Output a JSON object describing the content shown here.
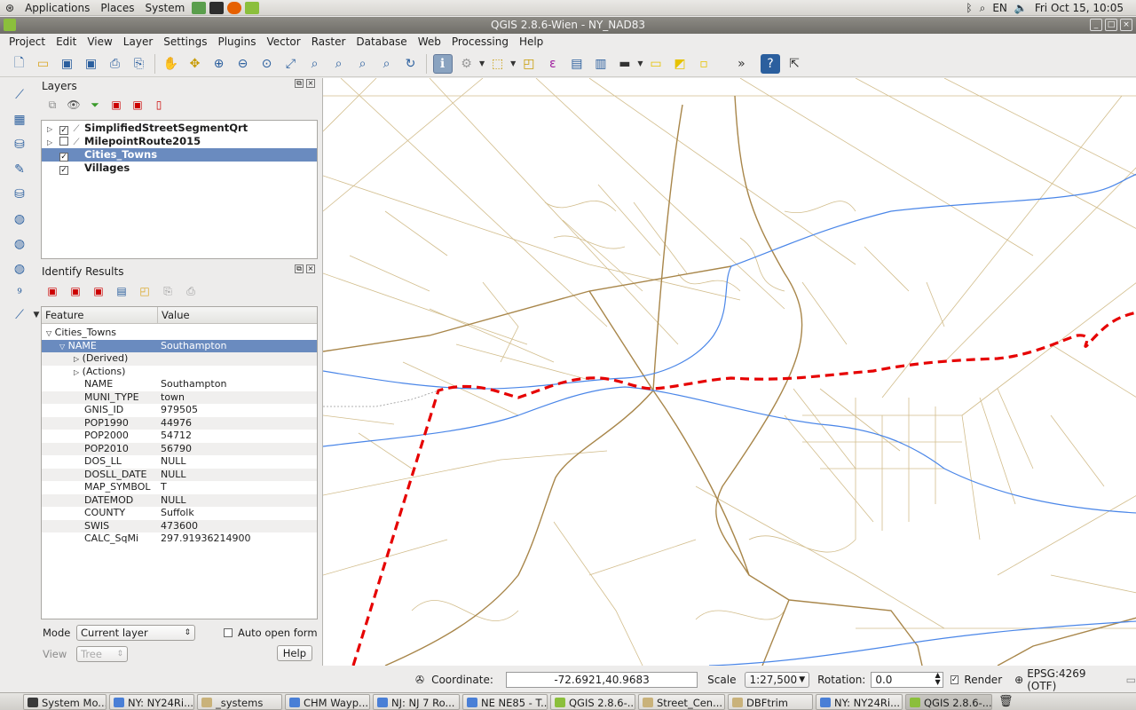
{
  "top_panel": {
    "applications": "Applications",
    "places": "Places",
    "system": "System",
    "lang": "EN",
    "clock": "Fri Oct 15, 10:05"
  },
  "window": {
    "title": "QGIS 2.8.6-Wien - NY_NAD83"
  },
  "menu": [
    "Project",
    "Edit",
    "View",
    "Layer",
    "Settings",
    "Plugins",
    "Vector",
    "Raster",
    "Database",
    "Web",
    "Processing",
    "Help"
  ],
  "toolbar": {
    "overflow": "»"
  },
  "layers_panel": {
    "title": "Layers",
    "items": [
      {
        "name": "SimplifiedStreetSegmentQrt",
        "checked": true,
        "expandable": true
      },
      {
        "name": "MilepointRoute2015",
        "checked": false,
        "expandable": true
      },
      {
        "name": "Cities_Towns",
        "checked": true,
        "expandable": false,
        "selected": true
      },
      {
        "name": "Villages",
        "checked": true,
        "expandable": false
      }
    ]
  },
  "identify_panel": {
    "title": "Identify Results",
    "headers": {
      "feature": "Feature",
      "value": "Value"
    },
    "layer": "Cities_Towns",
    "name_row": {
      "feature": "NAME",
      "value": "Southampton"
    },
    "derived": "(Derived)",
    "actions": "(Actions)",
    "attributes": [
      {
        "feature": "NAME",
        "value": "Southampton"
      },
      {
        "feature": "MUNI_TYPE",
        "value": "town"
      },
      {
        "feature": "GNIS_ID",
        "value": "979505"
      },
      {
        "feature": "POP1990",
        "value": "44976"
      },
      {
        "feature": "POP2000",
        "value": "54712"
      },
      {
        "feature": "POP2010",
        "value": "56790"
      },
      {
        "feature": "DOS_LL",
        "value": "NULL"
      },
      {
        "feature": "DOSLL_DATE",
        "value": "NULL"
      },
      {
        "feature": "MAP_SYMBOL",
        "value": "T"
      },
      {
        "feature": "DATEMOD",
        "value": "NULL"
      },
      {
        "feature": "COUNTY",
        "value": "Suffolk"
      },
      {
        "feature": "SWIS",
        "value": "473600"
      },
      {
        "feature": "CALC_SqMi",
        "value": "297.91936214900"
      }
    ],
    "mode_label": "Mode",
    "mode_value": "Current layer",
    "auto_open_label": "Auto open form",
    "view_label": "View",
    "view_value": "Tree",
    "help_label": "Help"
  },
  "status_bar": {
    "coordinate_label": "Coordinate:",
    "coordinate_value": "-72.6921,40.9683",
    "scale_label": "Scale",
    "scale_value": "1:27,500",
    "rotation_label": "Rotation:",
    "rotation_value": "0.0",
    "render_label": "Render",
    "crs": "EPSG:4269 (OTF)"
  },
  "taskbar": [
    {
      "label": "System Mo...",
      "color": "#3a3a3a"
    },
    {
      "label": "NY: NY24Ri...",
      "color": "#4a7fd6"
    },
    {
      "label": "_systems",
      "color": "#c9b27a"
    },
    {
      "label": "CHM Wayp...",
      "color": "#4a7fd6"
    },
    {
      "label": "NJ: NJ 7 Ro...",
      "color": "#4a7fd6"
    },
    {
      "label": "NE NE85 - T...",
      "color": "#4a7fd6"
    },
    {
      "label": "QGIS 2.8.6-...",
      "color": "#8bbf3c"
    },
    {
      "label": "Street_Cen...",
      "color": "#c9b27a"
    },
    {
      "label": "DBFtrim",
      "color": "#c9b27a"
    },
    {
      "label": "NY: NY24Ri...",
      "color": "#4a7fd6"
    },
    {
      "label": "QGIS 2.8.6-...",
      "color": "#8bbf3c",
      "active": true
    }
  ],
  "colors": {
    "street": "#c9ad6e",
    "major_road": "#a8864a",
    "river": "#4a86e8",
    "route": "#e60000",
    "selection": "#6a8bbf"
  }
}
